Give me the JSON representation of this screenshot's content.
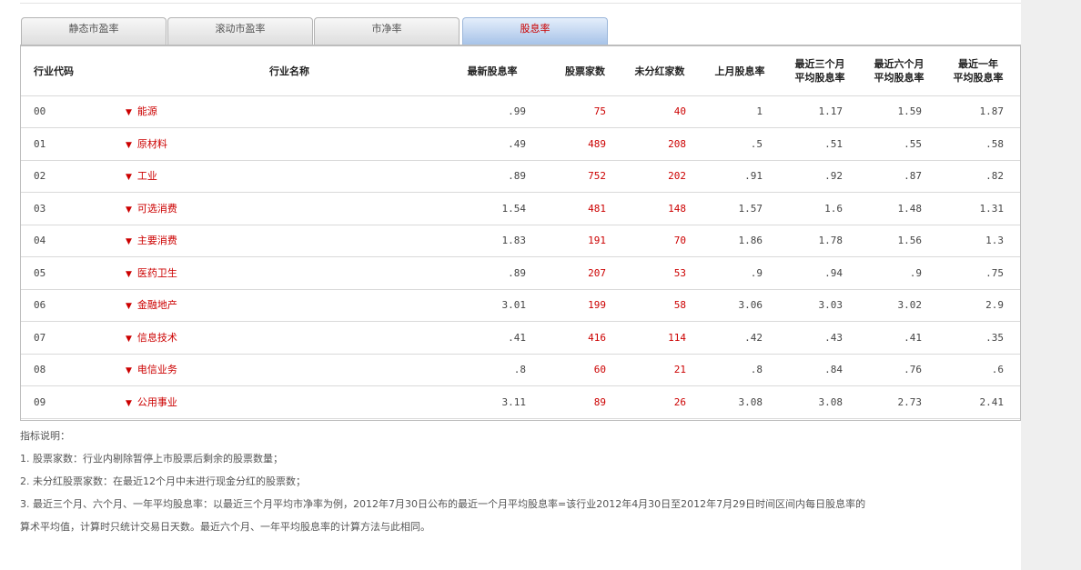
{
  "tabs": [
    {
      "label": "静态市盈率",
      "active": false
    },
    {
      "label": "滚动市盈率",
      "active": false
    },
    {
      "label": "市净率",
      "active": false
    },
    {
      "label": "股息率",
      "active": true
    }
  ],
  "table": {
    "headers": {
      "code": "行业代码",
      "name": "行业名称",
      "latest_yield": "最新股息率",
      "stock_count": "股票家数",
      "no_dividend_count": "未分红家数",
      "last_month_yield": [
        "上月股息率"
      ],
      "avg3m": [
        "最近三个月",
        "平均股息率"
      ],
      "avg6m": [
        "最近六个月",
        "平均股息率"
      ],
      "avg1y": [
        "最近一年",
        "平均股息率"
      ]
    },
    "rows": [
      {
        "code": "00",
        "name": "能源",
        "latest": ".99",
        "count": "75",
        "nodiv": "40",
        "last_month": "1",
        "avg3m": "1.17",
        "avg6m": "1.59",
        "avg1y": "1.87"
      },
      {
        "code": "01",
        "name": "原材料",
        "latest": ".49",
        "count": "489",
        "nodiv": "208",
        "last_month": ".5",
        "avg3m": ".51",
        "avg6m": ".55",
        "avg1y": ".58"
      },
      {
        "code": "02",
        "name": "工业",
        "latest": ".89",
        "count": "752",
        "nodiv": "202",
        "last_month": ".91",
        "avg3m": ".92",
        "avg6m": ".87",
        "avg1y": ".82"
      },
      {
        "code": "03",
        "name": "可选消费",
        "latest": "1.54",
        "count": "481",
        "nodiv": "148",
        "last_month": "1.57",
        "avg3m": "1.6",
        "avg6m": "1.48",
        "avg1y": "1.31"
      },
      {
        "code": "04",
        "name": "主要消费",
        "latest": "1.83",
        "count": "191",
        "nodiv": "70",
        "last_month": "1.86",
        "avg3m": "1.78",
        "avg6m": "1.56",
        "avg1y": "1.3"
      },
      {
        "code": "05",
        "name": "医药卫生",
        "latest": ".89",
        "count": "207",
        "nodiv": "53",
        "last_month": ".9",
        "avg3m": ".94",
        "avg6m": ".9",
        "avg1y": ".75"
      },
      {
        "code": "06",
        "name": "金融地产",
        "latest": "3.01",
        "count": "199",
        "nodiv": "58",
        "last_month": "3.06",
        "avg3m": "3.03",
        "avg6m": "3.02",
        "avg1y": "2.9"
      },
      {
        "code": "07",
        "name": "信息技术",
        "latest": ".41",
        "count": "416",
        "nodiv": "114",
        "last_month": ".42",
        "avg3m": ".43",
        "avg6m": ".41",
        "avg1y": ".35"
      },
      {
        "code": "08",
        "name": "电信业务",
        "latest": ".8",
        "count": "60",
        "nodiv": "21",
        "last_month": ".8",
        "avg3m": ".84",
        "avg6m": ".76",
        "avg1y": ".6"
      },
      {
        "code": "09",
        "name": "公用事业",
        "latest": "3.11",
        "count": "89",
        "nodiv": "26",
        "last_month": "3.08",
        "avg3m": "3.08",
        "avg6m": "2.73",
        "avg1y": "2.41"
      }
    ]
  },
  "notes": {
    "title": "指标说明：",
    "items": [
      "1. 股票家数：行业内剔除暂停上市股票后剩余的股票数量；",
      "2. 未分红股票家数：在最近12个月中未进行现金分红的股票数；",
      "3. 最近三个月、六个月、一年平均股息率：以最近三个月平均市净率为例，2012年7月30日公布的最近一个月平均股息率=该行业2012年4月30日至2012年7月29日时间区间内每日股息率的",
      "算术平均值，计算时只统计交易日天数。最近六个月、一年平均股息率的计算方法与此相同。"
    ]
  },
  "colors": {
    "accent_red": "#cc0000",
    "active_tab": "#a7c3e8"
  },
  "icons": {
    "expand": "caret-down-icon"
  }
}
